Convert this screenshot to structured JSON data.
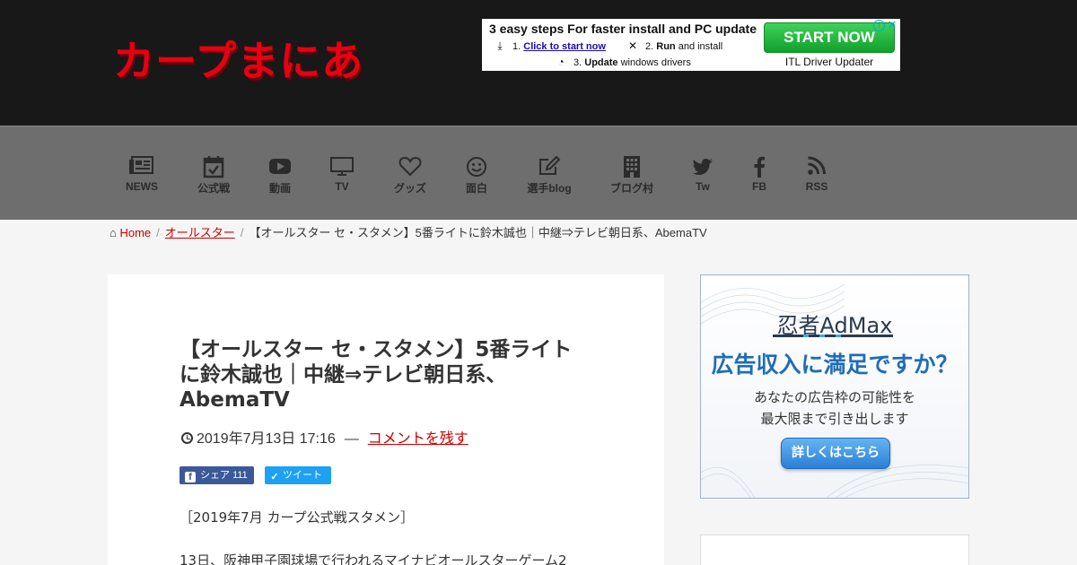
{
  "site": {
    "logo_text": "カープまにあ",
    "brand_color": "#e60012"
  },
  "header_ad": {
    "headline": "3 easy steps For faster install and PC update",
    "step1_prefix": "1.",
    "step1_link": "Click to start now",
    "step2_prefix": "2.",
    "step2_bold": "Run",
    "step2_rest": "and install",
    "step3_prefix": "3.",
    "step3_bold": "Update",
    "step3_rest": "windows drivers",
    "button_label": "START NOW",
    "brand": "ITL Driver Updater",
    "info_icon": "i",
    "close_icon": "✕"
  },
  "nav": {
    "items": [
      {
        "label": "NEWS",
        "icon": "newspaper-icon"
      },
      {
        "label": "公式戦",
        "icon": "calendar-check-icon"
      },
      {
        "label": "動画",
        "icon": "youtube-icon"
      },
      {
        "label": "TV",
        "icon": "tv-icon"
      },
      {
        "label": "グッズ",
        "icon": "heart-icon"
      },
      {
        "label": "面白",
        "icon": "smile-icon"
      },
      {
        "label": "選手blog",
        "icon": "edit-icon"
      },
      {
        "label": "ブログ村",
        "icon": "building-icon"
      },
      {
        "label": "Tw",
        "icon": "twitter-icon"
      },
      {
        "label": "FB",
        "icon": "facebook-icon"
      },
      {
        "label": "RSS",
        "icon": "rss-icon"
      }
    ]
  },
  "breadcrumb": {
    "home": "Home",
    "category": "オールスター",
    "current": "【オールスター セ・スタメン】5番ライトに鈴木誠也｜中継⇒テレビ朝日系、AbemaTV"
  },
  "article": {
    "title": "【オールスター セ・スタメン】5番ライトに鈴木誠也｜中継⇒テレビ朝日系、AbemaTV",
    "date": "2019年7月13日 17:16",
    "dash": "—",
    "comment_link": "コメントを残す",
    "share_fb_label": "シェア",
    "share_fb_count": "111",
    "share_tw_label": "ツイート",
    "paragraph1": "［2019年7月 カープ公式戦スタメン］",
    "paragraph2": "13日、阪神甲子園球場で行われるマイナビオールスターゲーム2"
  },
  "side_ad": {
    "brand": "忍者AdMax",
    "headline": "広告収入に満足ですか？",
    "sub_line1": "あなたの広告枠の可能性を",
    "sub_line2": "最大限まで引き出します",
    "button_label": "詳しくはこちら"
  },
  "colors": {
    "header_bg": "#181818",
    "nav_bg": "#6e6e6e",
    "link_red": "#cc0000",
    "fb_blue": "#3b5998",
    "tw_blue": "#1da1f2"
  }
}
